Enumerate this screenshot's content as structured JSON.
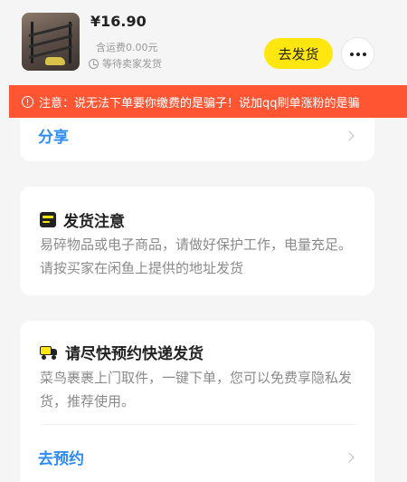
{
  "product": {
    "price": "¥16.90",
    "shipping_fee": "含运费0.00元",
    "status": "等待卖家发货"
  },
  "actions": {
    "ship_label": "去发货"
  },
  "warning": {
    "text": "注意：说无法下单要你缴费的是骗子！说加qq刷单涨粉的是骗"
  },
  "share": {
    "label": "分享"
  },
  "notice": {
    "title": "发货注意",
    "body": "易碎物品或电子商品，请做好保护工作，电量充足。请按买家在闲鱼上提供的地址发货"
  },
  "booking": {
    "title": "请尽快预约快递发货",
    "body": "菜鸟裹裹上门取件，一键下单，您可以免费享隐私发货，推荐使用。",
    "link": "去预约"
  },
  "colors": {
    "accent_yellow": "#ffe60f",
    "warning_red": "#ff5533",
    "link_blue": "#2f8cf5"
  }
}
